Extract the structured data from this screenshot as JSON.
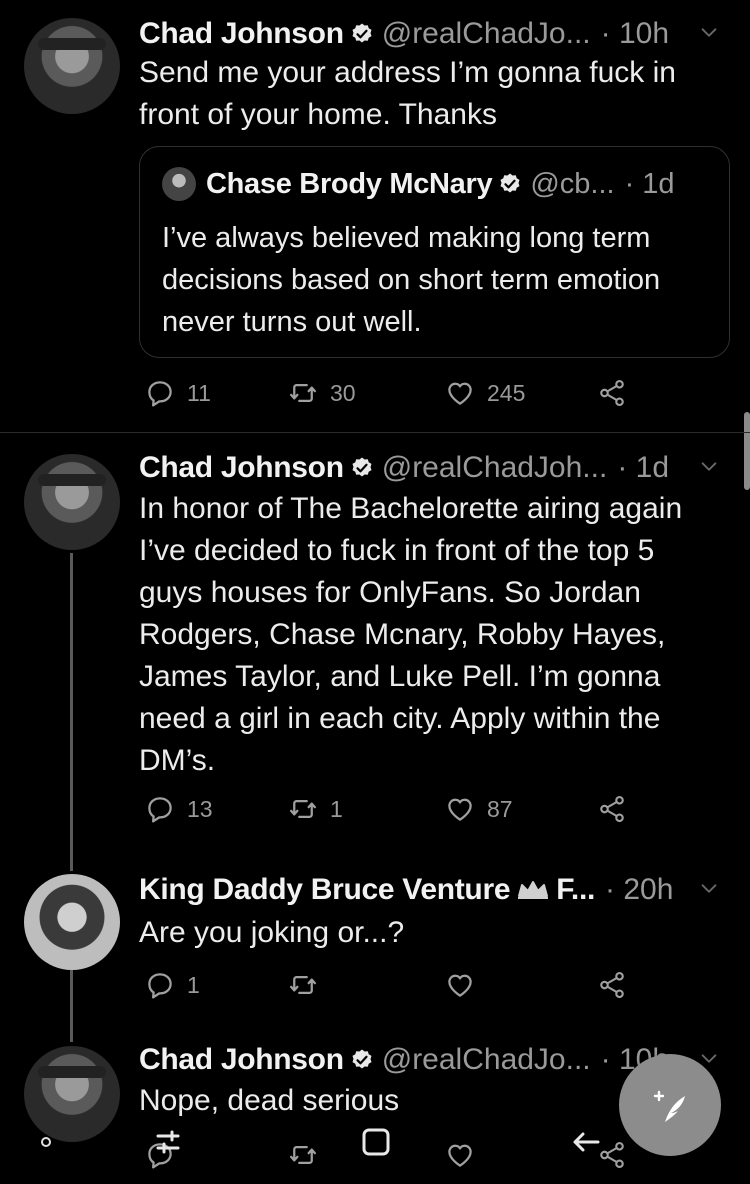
{
  "tweets": [
    {
      "name": "Chad Johnson",
      "handle": "@realChadJo...",
      "time": "· 10h",
      "text": "Send me your address I’m gonna fuck in front of your home. Thanks",
      "quote": {
        "name": "Chase Brody McNary",
        "handle": "@cb...",
        "time": "· 1d",
        "text": "I’ve always believed making long term decisions based on short term emotion never turns out well."
      },
      "replies": "11",
      "retweets": "30",
      "likes": "245"
    },
    {
      "name": "Chad Johnson",
      "handle": "@realChadJoh...",
      "time": "· 1d",
      "text": "In honor of The Bachelorette airing again I’ve decided to fuck in front of the top 5 guys houses for OnlyFans. So Jordan Rodgers, Chase Mcnary, Robby Hayes, James Taylor, and Luke Pell. I’m gonna need a girl in each city. Apply within the DM’s.",
      "replies": "13",
      "retweets": "1",
      "likes": "87"
    },
    {
      "name": "King Daddy Bruce Venture",
      "handle": "F...",
      "time": "· 20h",
      "text": "Are you joking or...?",
      "replies": "1",
      "retweets": "",
      "likes": ""
    },
    {
      "name": "Chad Johnson",
      "handle": "@realChadJo...",
      "time": "· 10h",
      "text": "Nope, dead serious"
    }
  ],
  "icons": {
    "verified": "verified-badge-icon",
    "chevron": "chevron-down-icon",
    "reply": "reply-icon",
    "retweet": "retweet-icon",
    "like": "heart-icon",
    "share": "share-icon",
    "compose": "compose-feather-icon",
    "crown": "crown-icon"
  },
  "colors": {
    "background": "#000000",
    "text": "#e8e8e8",
    "muted": "#9a9a9a",
    "fab": "#8c8c8c"
  }
}
